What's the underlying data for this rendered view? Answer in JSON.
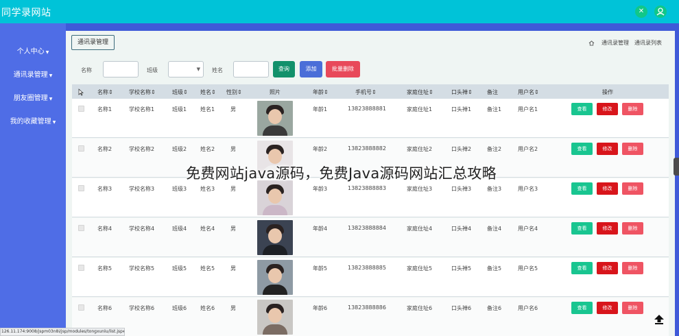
{
  "app": {
    "title": "同学录网站"
  },
  "header_icons": [
    "tools-icon",
    "user-icon"
  ],
  "sidebar": {
    "items": [
      {
        "label": "个人中心"
      },
      {
        "label": "通讯录管理"
      },
      {
        "label": "朋友圈管理"
      },
      {
        "label": "我的收藏管理"
      }
    ]
  },
  "page": {
    "tab_label": "通讯录管理",
    "breadcrumb": [
      "通讯录管理",
      "通讯录列表"
    ]
  },
  "search": {
    "name_label": "名称",
    "class_label": "班级",
    "person_label": "姓名",
    "query_btn": "查询",
    "add_btn": "添加",
    "batch_delete_btn": "批量删除"
  },
  "table": {
    "columns": [
      "名称",
      "学校名称",
      "班级",
      "姓名",
      "性别",
      "照片",
      "年龄",
      "手机号",
      "家庭住址",
      "口头禅",
      "备注",
      "用户名",
      "操作"
    ],
    "rows": [
      {
        "name": "名称1",
        "school": "学校名称1",
        "class": "班级1",
        "person": "姓名1",
        "gender": "男",
        "age": "年龄1",
        "phone": "13823888881",
        "address": "家庭住址1",
        "motto": "口头禅1",
        "note": "备注1",
        "user": "用户名1"
      },
      {
        "name": "名称2",
        "school": "学校名称2",
        "class": "班级2",
        "person": "姓名2",
        "gender": "男",
        "age": "年龄2",
        "phone": "13823888882",
        "address": "家庭住址2",
        "motto": "口头禅2",
        "note": "备注2",
        "user": "用户名2"
      },
      {
        "name": "名称3",
        "school": "学校名称3",
        "class": "班级3",
        "person": "姓名3",
        "gender": "男",
        "age": "年龄3",
        "phone": "13823888883",
        "address": "家庭住址3",
        "motto": "口头禅3",
        "note": "备注3",
        "user": "用户名3"
      },
      {
        "name": "名称4",
        "school": "学校名称4",
        "class": "班级4",
        "person": "姓名4",
        "gender": "男",
        "age": "年龄4",
        "phone": "13823888884",
        "address": "家庭住址4",
        "motto": "口头禅4",
        "note": "备注4",
        "user": "用户名4"
      },
      {
        "name": "名称5",
        "school": "学校名称5",
        "class": "班级5",
        "person": "姓名5",
        "gender": "男",
        "age": "年龄5",
        "phone": "13823888885",
        "address": "家庭住址5",
        "motto": "口头禅5",
        "note": "备注5",
        "user": "用户名5"
      },
      {
        "name": "名称6",
        "school": "学校名称6",
        "class": "班级6",
        "person": "姓名6",
        "gender": "男",
        "age": "年龄6",
        "phone": "13823888886",
        "address": "家庭住址6",
        "motto": "口头禅6",
        "note": "备注6",
        "user": "用户名6"
      }
    ],
    "row_actions": {
      "view": "查看",
      "edit": "修改",
      "delete": "删除"
    }
  },
  "overlay": {
    "caption": "免费网站java源码，免费Java源码网站汇总攻略"
  },
  "statusbar": {
    "url": "126.11.174:9008/jspm03n8i/jsp/modules/tongxunlu/list.jsp#"
  },
  "colors": {
    "topbar": "#00c3d8",
    "sidebar": "#4f6de6",
    "query": "#12916b",
    "add": "#4a6ed8",
    "batch_delete": "#e8495a",
    "view": "#19c590",
    "edit": "#d8151b",
    "delete": "#ef5463"
  }
}
